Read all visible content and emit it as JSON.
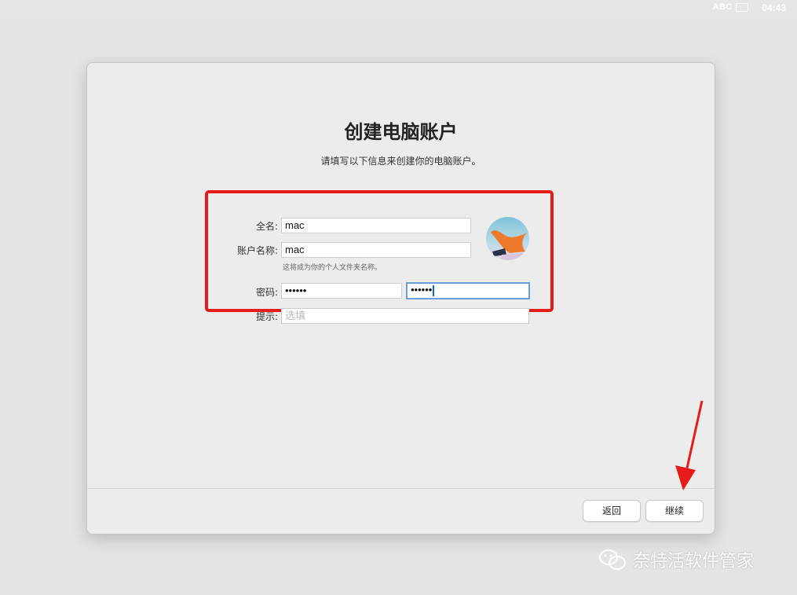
{
  "menubar": {
    "input_source": "ABC",
    "time": "04:43"
  },
  "title": "创建电脑账户",
  "subtitle": "请填写以下信息来创建你的电脑账户。",
  "form": {
    "full_name": {
      "label": "全名:",
      "value": "mac"
    },
    "account_name": {
      "label": "账户名称:",
      "value": "mac",
      "note": "这将成为你的个人文件夹名称。"
    },
    "password": {
      "label": "密码:",
      "value": "••••••",
      "verify_value": "••••••"
    },
    "hint": {
      "label": "提示:",
      "placeholder": "选填"
    }
  },
  "buttons": {
    "back": "返回",
    "continue": "继续"
  },
  "watermark": "奈特活软件管家",
  "colors": {
    "highlight_box": "#e81b1b",
    "focus_ring": "#6d9edc",
    "arrow": "#e81b1b"
  }
}
